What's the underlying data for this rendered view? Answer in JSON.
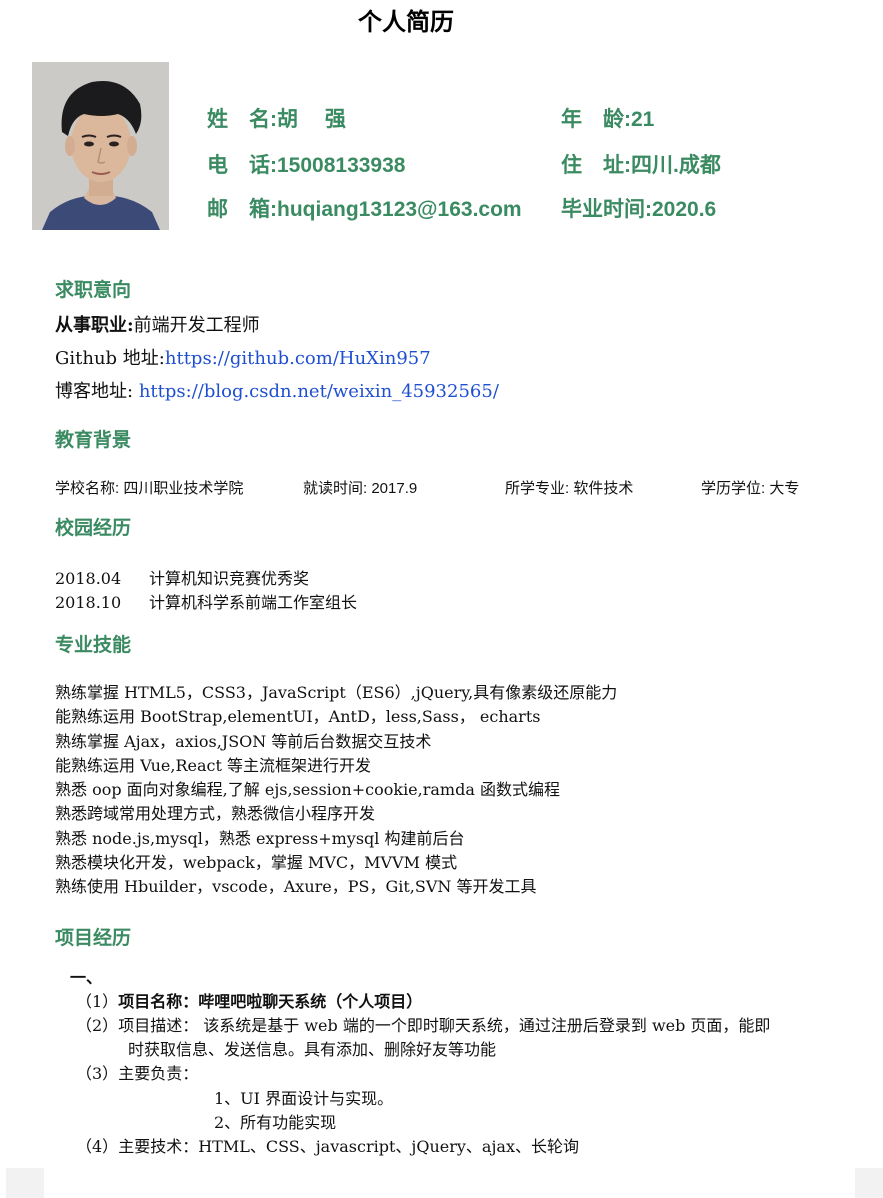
{
  "header": {
    "title": "个人简历"
  },
  "personal": {
    "name_label": "姓　名:",
    "name_value": "胡　 强",
    "age_label": "年　龄:",
    "age_value": "21",
    "phone_label": "电　话:",
    "phone_value": "15008133938",
    "address_label": "住　址:",
    "address_value": "四川.成都",
    "email_label": "邮　箱:",
    "email_value": "huqiang13123@163.com",
    "grad_label": "毕业时间:",
    "grad_value": "2020.6"
  },
  "job_intent": {
    "heading": "求职意向",
    "occupation_label": "从事职业:",
    "occupation_value": "前端开发工程师",
    "github_label": "Github 地址:",
    "github_url": "https://github.com/HuXin957",
    "blog_label": "博客地址:",
    "blog_url": "https://blog.csdn.net/weixin_45932565/"
  },
  "education": {
    "heading": "教育背景",
    "school": "学校名称: 四川职业技术学院",
    "period": "就读时间: 2017.9",
    "major": "所学专业: 软件技术",
    "degree": "学历学位: 大专"
  },
  "campus": {
    "heading": "校园经历",
    "items": [
      {
        "date": "2018.04",
        "text": "计算机知识竞赛优秀奖"
      },
      {
        "date": "2018.10",
        "text": "计算机科学系前端工作室组长"
      }
    ]
  },
  "skills": {
    "heading": "专业技能",
    "items": [
      "熟练掌握 HTML5，CSS3，JavaScript（ES6）,jQuery,具有像素级还原能力",
      "能熟练运用 BootStrap,elementUI，AntD，less,Sass， echarts",
      "熟练掌握 Ajax，axios,JSON 等前后台数据交互技术",
      "能熟练运用 Vue,React 等主流框架进行开发",
      "熟悉 oop 面向对象编程,了解 ejs,session+cookie,ramda 函数式编程",
      "熟悉跨域常用处理方式，熟悉微信小程序开发",
      "熟悉 node.js,mysql，熟悉 express+mysql 构建前后台",
      "熟悉模块化开发，webpack，掌握 MVC，MVVM 模式",
      "熟练使用 Hbuilder，vscode，Axure，PS，Git,SVN 等开发工具"
    ]
  },
  "projects": {
    "heading": "项目经历",
    "index": "一、",
    "name_prefix": "（1）",
    "name": "项目名称：哔哩吧啦聊天系统（个人项目）",
    "desc_prefix": "（2）",
    "desc_line1": "项目描述：  该系统是基于 web 端的一个即时聊天系统，通过注册后登录到 web 页面，能即",
    "desc_line2": "时获取信息、发送信息。具有添加、删除好友等功能",
    "resp_prefix": "（3）",
    "resp_label": "主要负责：",
    "resp_items": [
      "1、UI 界面设计与实现。",
      "2、所有功能实现"
    ],
    "tech_prefix": "（4）",
    "tech": "主要技术：HTML、CSS、javascript、jQuery、ajax、长轮询"
  }
}
